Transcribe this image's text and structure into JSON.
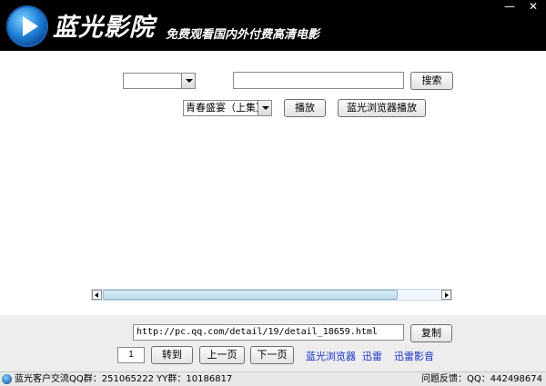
{
  "titlebar": {
    "app_name": "蓝光影院",
    "slogan": "免费观看国内外付费高清电影",
    "minimize": "—",
    "close": "✕"
  },
  "search": {
    "category_value": "",
    "query_value": "",
    "button_label": "搜索"
  },
  "play": {
    "episode_value": "青春盛宴（上集）",
    "play_label": "播放",
    "browser_play_label": "蓝光浏览器播放"
  },
  "bottom": {
    "url_value": "http://pc.qq.com/detail/19/detail_18659.html",
    "copy_label": "复制",
    "page_value": "1",
    "goto_label": "转到",
    "prev_label": "上一页",
    "next_label": "下一页",
    "links": [
      "蓝光浏览器",
      "迅雷",
      "迅雷影音"
    ]
  },
  "status": {
    "left": "蓝光客户交流QQ群：251065222   YY群：10186817",
    "right": "问题反馈：QQ：442498674"
  },
  "colors": {
    "titlebar_bg": "#000000",
    "link": "#1530c8",
    "panel_bg": "#ededed"
  },
  "icons": [
    "play-logo-icon",
    "minimize-icon",
    "close-icon",
    "dropdown-arrow-icon",
    "scroll-left-icon",
    "scroll-right-icon",
    "status-logo-icon"
  ]
}
